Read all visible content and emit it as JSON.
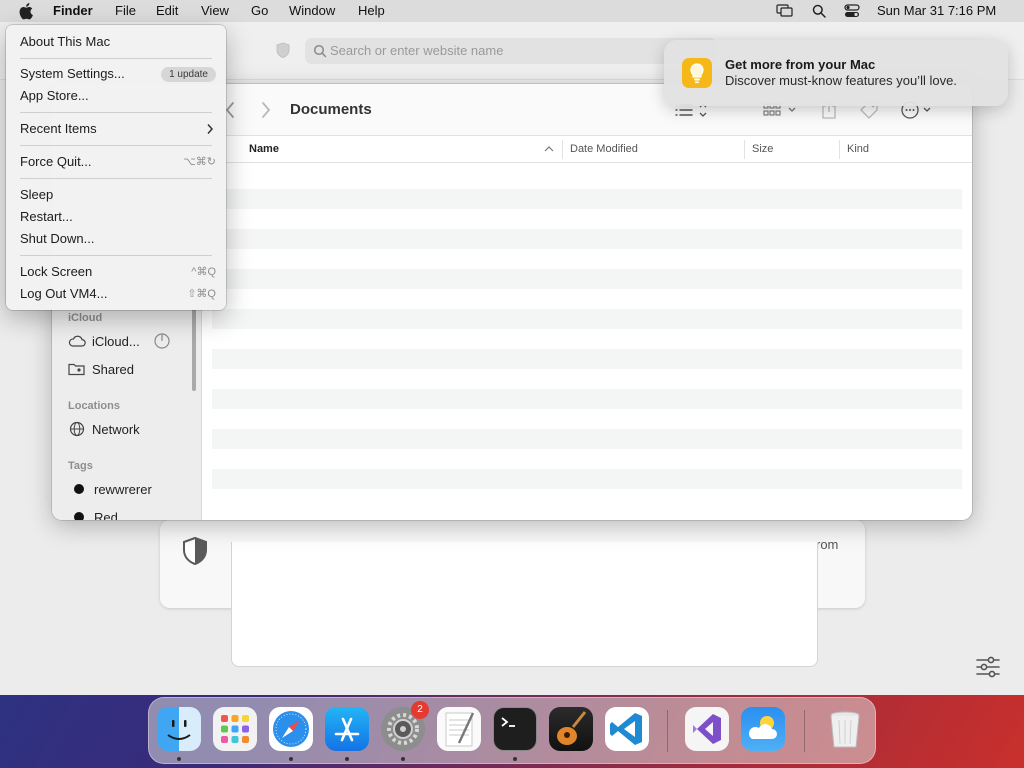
{
  "menubar": {
    "app_name": "Finder",
    "items": [
      "File",
      "Edit",
      "View",
      "Go",
      "Window",
      "Help"
    ],
    "clock": "Sun Mar 31  7:16 PM",
    "status_icons": [
      "screen-mirroring-icon",
      "spotlight-search-icon",
      "control-center-icon"
    ]
  },
  "safari": {
    "address_placeholder": "Search or enter website name",
    "privacy_text_tail": "rom"
  },
  "apple_menu": {
    "items": [
      {
        "label": "About This Mac",
        "shortcut": ""
      },
      {
        "label": "System Settings...",
        "badge": "1 update"
      },
      {
        "label": "App Store..."
      },
      {
        "label": "Recent Items",
        "submenu": true
      },
      {
        "label": "Force Quit...",
        "shortcut": "⌥⌘↻"
      },
      {
        "label": "Sleep"
      },
      {
        "label": "Restart..."
      },
      {
        "label": "Shut Down..."
      },
      {
        "label": "Lock Screen",
        "shortcut": "^⌘Q"
      },
      {
        "label": "Log Out VM4...",
        "shortcut": "⇧⌘Q"
      }
    ]
  },
  "notification": {
    "title": "Get more from your Mac",
    "body": "Discover must-know features you’ll love."
  },
  "finder": {
    "folder_title": "Documents",
    "columns": [
      "Name",
      "Date Modified",
      "Size",
      "Kind"
    ],
    "sidebar": {
      "icloud_header": "iCloud",
      "icloud_items": [
        "iCloud...",
        "Shared"
      ],
      "locations_header": "Locations",
      "locations_items": [
        "Network"
      ],
      "tags_header": "Tags",
      "tags_items": [
        "rewwrerer",
        "Red"
      ]
    }
  },
  "dock": {
    "apps": [
      "Finder",
      "Launchpad",
      "Safari",
      "App Store",
      "System Settings",
      "TextEdit",
      "Terminal",
      "GarageBand",
      "Visual Studio Code",
      "Visual Studio",
      "Weather",
      "Trash"
    ],
    "badge": "2"
  }
}
